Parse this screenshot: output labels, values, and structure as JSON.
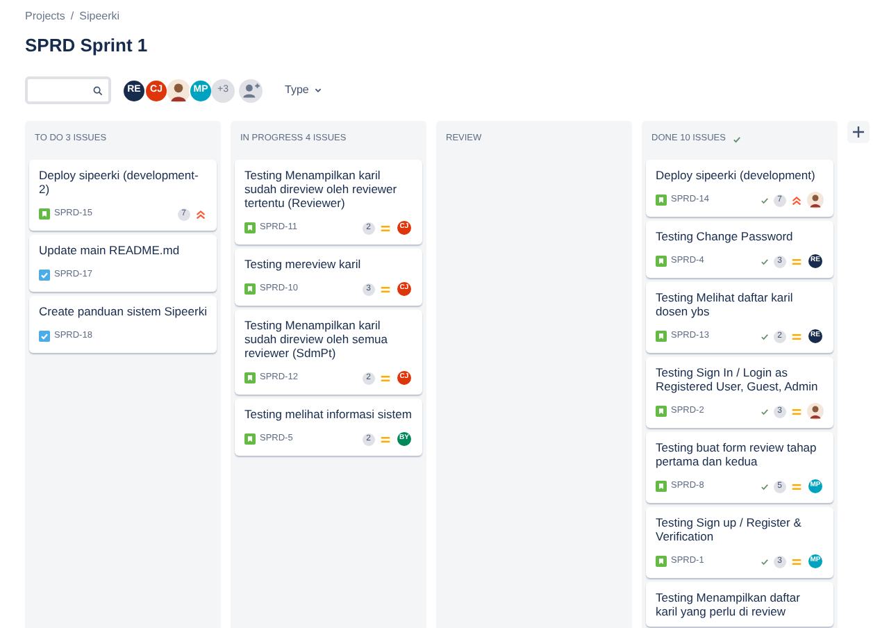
{
  "breadcrumbs": [
    {
      "label": "Projects"
    },
    {
      "label": "Sipeerki"
    }
  ],
  "breadcrumb_separator": "/",
  "title": "SPRD Sprint 1",
  "avatars": [
    {
      "kind": "initials",
      "text": "RE",
      "color": "#172b4d"
    },
    {
      "kind": "initials",
      "text": "CJ",
      "color": "#de350b"
    },
    {
      "kind": "photo"
    },
    {
      "kind": "initials",
      "text": "MP",
      "color": "#00a3bf"
    },
    {
      "kind": "count",
      "text": "+3"
    }
  ],
  "type_filter": "Type",
  "columns": [
    {
      "title": "TO DO 3 ISSUES",
      "cards": [
        {
          "title": "Deploy sipeerki (development-2)",
          "kind": "story",
          "key": "SPRD-15",
          "estimate": "7",
          "priority": {
            "kind": "high"
          }
        },
        {
          "title": "Update main README.md",
          "kind": "task",
          "key": "SPRD-17"
        },
        {
          "title": "Create panduan sistem Sipeerki",
          "kind": "task",
          "key": "SPRD-18"
        }
      ]
    },
    {
      "title": "IN PROGRESS 4 ISSUES",
      "cards": [
        {
          "title": "Testing Menampilkan karil sudah direview oleh reviewer tertentu (Reviewer)",
          "kind": "story",
          "key": "SPRD-11",
          "estimate": "2",
          "priority": {
            "kind": "medium"
          },
          "assignee": {
            "kind": "initials",
            "text": "CJ",
            "color": "#de350b"
          }
        },
        {
          "title": "Testing mereview karil",
          "kind": "story",
          "key": "SPRD-10",
          "estimate": "3",
          "priority": {
            "kind": "medium"
          },
          "assignee": {
            "kind": "initials",
            "text": "CJ",
            "color": "#de350b"
          }
        },
        {
          "title": "Testing Menampilkan karil sudah direview oleh semua reviewer (SdmPt)",
          "kind": "story",
          "key": "SPRD-12",
          "estimate": "2",
          "priority": {
            "kind": "medium"
          },
          "assignee": {
            "kind": "initials",
            "text": "CJ",
            "color": "#de350b"
          }
        },
        {
          "title": "Testing melihat informasi sistem",
          "kind": "story",
          "key": "SPRD-5",
          "estimate": "2",
          "priority": {
            "kind": "medium"
          },
          "assignee": {
            "kind": "initials",
            "text": "BY",
            "color": "#00875a"
          }
        }
      ]
    },
    {
      "title": "REVIEW"
    },
    {
      "title": "DONE 10 ISSUES",
      "done_check": true,
      "cards": [
        {
          "title": "Deploy sipeerki (development)",
          "kind": "story",
          "key": "SPRD-14",
          "done": true,
          "estimate": "7",
          "priority": {
            "kind": "high"
          },
          "assignee": {
            "kind": "photo"
          }
        },
        {
          "title": "Testing Change Password",
          "kind": "story",
          "key": "SPRD-4",
          "done": true,
          "estimate": "3",
          "priority": {
            "kind": "medium"
          },
          "assignee": {
            "kind": "initials",
            "text": "RE",
            "color": "#172b4d"
          }
        },
        {
          "title": "Testing Melihat daftar karil dosen ybs",
          "kind": "story",
          "key": "SPRD-13",
          "done": true,
          "estimate": "2",
          "priority": {
            "kind": "medium"
          },
          "assignee": {
            "kind": "initials",
            "text": "RE",
            "color": "#172b4d"
          }
        },
        {
          "title": "Testing Sign In / Login as Registered User, Guest, Admin",
          "kind": "story",
          "key": "SPRD-2",
          "done": true,
          "estimate": "3",
          "priority": {
            "kind": "medium"
          },
          "assignee": {
            "kind": "photo"
          }
        },
        {
          "title": "Testing buat form review tahap pertama dan kedua",
          "kind": "story",
          "key": "SPRD-8",
          "done": true,
          "estimate": "5",
          "priority": {
            "kind": "medium"
          },
          "assignee": {
            "kind": "initials",
            "text": "MP",
            "color": "#00a3bf"
          }
        },
        {
          "title": "Testing Sign up / Register & Verification",
          "kind": "story",
          "key": "SPRD-1",
          "done": true,
          "estimate": "3",
          "priority": {
            "kind": "medium"
          },
          "assignee": {
            "kind": "initials",
            "text": "MP",
            "color": "#00a3bf"
          }
        },
        {
          "title": "Testing Menampilkan daftar karil yang perlu di review"
        }
      ]
    }
  ]
}
